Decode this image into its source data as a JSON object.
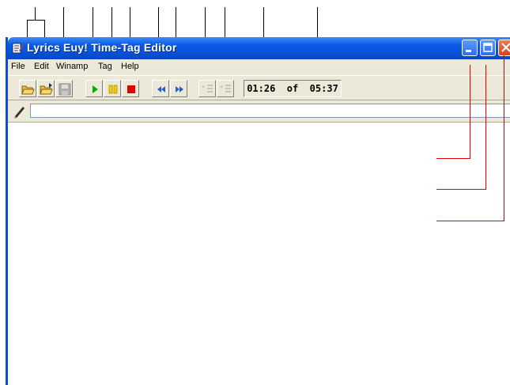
{
  "window": {
    "title": "Lyrics Euy! Time-Tag Editor"
  },
  "menu": [
    "File",
    "Edit",
    "Winamp",
    "Tag",
    "Help"
  ],
  "toolbar": {
    "buttons": [
      {
        "name": "open-icon"
      },
      {
        "name": "open-folder-icon"
      },
      {
        "name": "save-icon",
        "disabled": true
      },
      {
        "name": "play-icon",
        "color": "#00b000"
      },
      {
        "name": "pause-icon",
        "color": "#f0d000"
      },
      {
        "name": "stop-icon",
        "color": "#e00000"
      },
      {
        "name": "rewind-icon",
        "color": "#2860c8"
      },
      {
        "name": "fast-forward-icon",
        "color": "#2860c8"
      },
      {
        "name": "add-tag-icon",
        "disabled": true
      },
      {
        "name": "remove-tag-icon",
        "disabled": true
      }
    ],
    "time_display": "01:26  of  05:37"
  },
  "editor": {
    "tag_input_value": ""
  },
  "colors": {
    "titlebar": "#0a5ae6",
    "chrome": "#ece9d8",
    "callout_black": "#000000",
    "callout_red": "#e00000"
  }
}
